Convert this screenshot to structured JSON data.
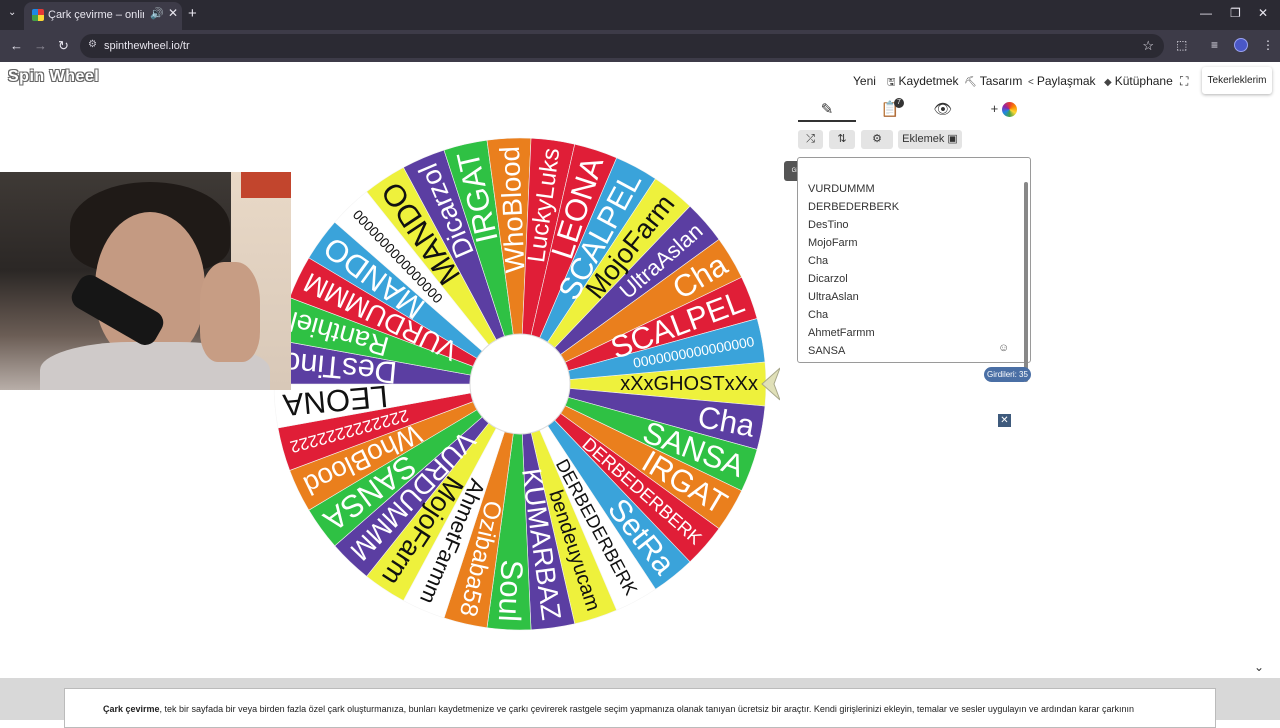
{
  "browser": {
    "tab_title": "Çark çevirme – online karar",
    "url": "spinthewheel.io/tr",
    "new_tab": "+",
    "close_tab": "✕"
  },
  "app": {
    "logo": "Spin Wheel",
    "menu": [
      {
        "label": "Yeni",
        "icon": ""
      },
      {
        "label": "Kaydetmek",
        "icon": "save-icon"
      },
      {
        "label": "Tasarım",
        "icon": "paint-roller-icon"
      },
      {
        "label": "Paylaşmak",
        "icon": "share-icon"
      },
      {
        "label": "Kütüphane",
        "icon": "layers-icon"
      }
    ],
    "my_wheels_button": "Tekerleklerim"
  },
  "panel": {
    "tab_badge": "7",
    "add_label": "Eklemek",
    "tooltip": "Girdileri Karıştır",
    "entries": [
      "VURDUMMM",
      "DERBEDERBERK",
      "DesTino",
      "MojoFarm",
      "Cha",
      "Dicarzol",
      "UltraAslan",
      "Cha",
      "AhmetFarmm",
      "SANSA"
    ],
    "count_badge": "Girdileri: 35",
    "close_symbol": "✕"
  },
  "wheel": {
    "segments": [
      {
        "label": "xXxGHOSTxXx",
        "color": "#eef13c"
      },
      {
        "label": "Cha",
        "color": "#5b3ea2"
      },
      {
        "label": "SANSA",
        "color": "#2fc144"
      },
      {
        "label": "IRGAT",
        "color": "#ea7f1d"
      },
      {
        "label": "DERBEDERBERK",
        "color": "#e01e37"
      },
      {
        "label": "SetRa",
        "color": "#3aa3da"
      },
      {
        "label": "DERBEDERBERK",
        "color": "#ffffff"
      },
      {
        "label": "bendeuyucam",
        "color": "#eef13c"
      },
      {
        "label": "KUMARBAZ",
        "color": "#5b3ea2"
      },
      {
        "label": "Soul",
        "color": "#2fc144"
      },
      {
        "label": "Ozibaba58",
        "color": "#ea7f1d"
      },
      {
        "label": "AhmetFarmm",
        "color": "#ffffff"
      },
      {
        "label": "MojoFarm",
        "color": "#eef13c"
      },
      {
        "label": "VURDUMMM",
        "color": "#5b3ea2"
      },
      {
        "label": "SANSA",
        "color": "#2fc144"
      },
      {
        "label": "WhoBlood",
        "color": "#ea7f1d"
      },
      {
        "label": "2222222222222",
        "color": "#e01e37"
      },
      {
        "label": "LEONA",
        "color": "#ffffff"
      },
      {
        "label": "DesTino",
        "color": "#5b3ea2"
      },
      {
        "label": "Ranthiel",
        "color": "#2fc144"
      },
      {
        "label": "VURDUMMM",
        "color": "#e01e37"
      },
      {
        "label": "MANDO",
        "color": "#3aa3da"
      },
      {
        "label": "0000000000000000",
        "color": "#ffffff"
      },
      {
        "label": "MANDO",
        "color": "#eef13c"
      },
      {
        "label": "Dicarzol",
        "color": "#5b3ea2"
      },
      {
        "label": "IRGAT",
        "color": "#2fc144"
      },
      {
        "label": "WhoBlood",
        "color": "#ea7f1d"
      },
      {
        "label": "LuckyLuks",
        "color": "#e01e37"
      },
      {
        "label": "LEONA",
        "color": "#e01e37"
      },
      {
        "label": "SCALPEL",
        "color": "#3aa3da"
      },
      {
        "label": "MojoFarm",
        "color": "#eef13c"
      },
      {
        "label": "UltraAslan",
        "color": "#5b3ea2"
      },
      {
        "label": "Cha",
        "color": "#ea7f1d"
      },
      {
        "label": "SCALPEL",
        "color": "#e01e37"
      },
      {
        "label": "0000000000000000",
        "color": "#3aa3da"
      }
    ]
  },
  "footer": {
    "bold": "Çark çevirme",
    "text": ", tek bir sayfada bir veya birden fazla özel çark oluşturmanıza, bunları kaydetmenize ve çarkı çevirerek rastgele seçim yapmanıza olanak tanıyan ücretsiz bir araçtır. Kendi girişlerinizi ekleyin, temalar ve sesler uygulayın ve ardından karar çarkının"
  }
}
